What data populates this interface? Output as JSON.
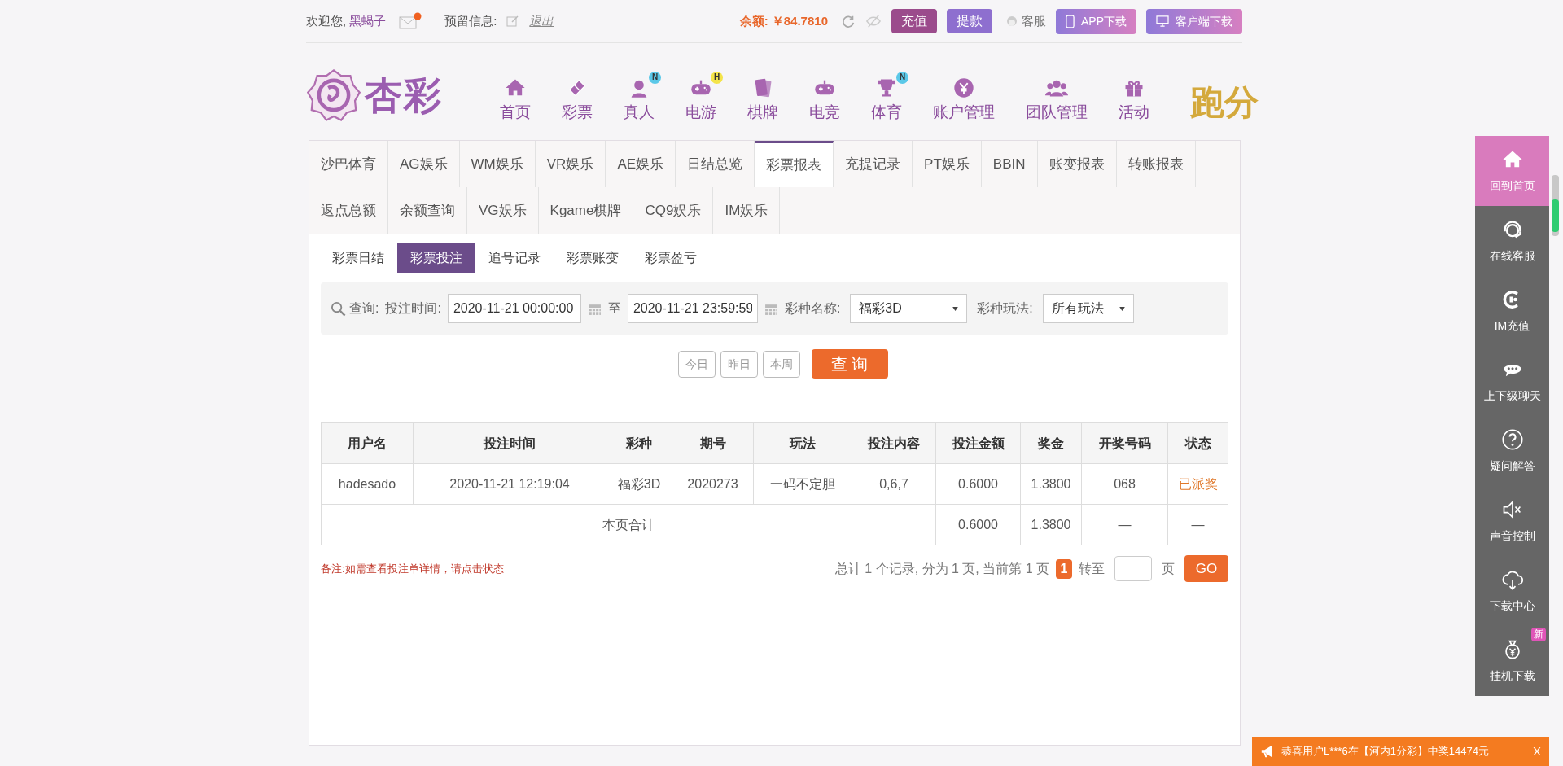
{
  "top_bar": {
    "welcome": "欢迎您,",
    "username": "黑蝎子",
    "reserved_label": "预留信息:",
    "logout": "退出",
    "balance_label": "余额:",
    "balance": "￥84.7810",
    "buttons": [
      {
        "label": "充值",
        "kind": "deposit"
      },
      {
        "label": "提款",
        "kind": "withdraw"
      }
    ],
    "service": "客服",
    "downloads": [
      {
        "label": "APP下载",
        "kind": "phone"
      },
      {
        "label": "客户端下载",
        "kind": "desktop"
      }
    ]
  },
  "logo": {
    "text": "杏彩"
  },
  "nav": [
    {
      "label": "首页"
    },
    {
      "label": "彩票"
    },
    {
      "label": "真人",
      "badge": "N"
    },
    {
      "label": "电游",
      "badge": "H"
    },
    {
      "label": "棋牌"
    },
    {
      "label": "电竞"
    },
    {
      "label": "体育",
      "badge": "N"
    },
    {
      "label": "账户管理"
    },
    {
      "label": "团队管理"
    },
    {
      "label": "活动"
    }
  ],
  "nav_promo": "跑分",
  "report_tabs": [
    {
      "label": "沙巴体育",
      "selected": false
    },
    {
      "label": "AG娱乐",
      "selected": false
    },
    {
      "label": "WM娱乐",
      "selected": false
    },
    {
      "label": "VR娱乐",
      "selected": false
    },
    {
      "label": "AE娱乐",
      "selected": false
    },
    {
      "label": "日结总览",
      "selected": false
    },
    {
      "label": "彩票报表",
      "selected": true
    },
    {
      "label": "充提记录",
      "selected": false
    },
    {
      "label": "PT娱乐",
      "selected": false
    },
    {
      "label": "BBIN",
      "selected": false
    },
    {
      "label": "账变报表",
      "selected": false
    },
    {
      "label": "转账报表",
      "selected": false
    },
    {
      "label": "返点总额",
      "selected": false
    },
    {
      "label": "余额查询",
      "selected": false
    },
    {
      "label": "VG娱乐",
      "selected": false
    },
    {
      "label": "Kgame棋牌",
      "selected": false
    },
    {
      "label": "CQ9娱乐",
      "selected": false
    },
    {
      "label": "IM娱乐",
      "selected": false
    }
  ],
  "sub_tabs": [
    {
      "label": "彩票日结",
      "selected": false
    },
    {
      "label": "彩票投注",
      "selected": true
    },
    {
      "label": "追号记录",
      "selected": false
    },
    {
      "label": "彩票账变",
      "selected": false
    },
    {
      "label": "彩票盈亏",
      "selected": false
    }
  ],
  "search": {
    "label": "查询:",
    "time_label": "投注时间:",
    "start": "2020-11-21 00:00:00",
    "to": "至",
    "end": "2020-11-21 23:59:59",
    "lottery_label": "彩种名称:",
    "lottery": "福彩3D",
    "play_label": "彩种玩法:",
    "play": "所有玩法",
    "quick": [
      "今日",
      "昨日",
      "本周"
    ],
    "submit": "查 询"
  },
  "table": {
    "columns": [
      "用户名",
      "投注时间",
      "彩种",
      "期号",
      "玩法",
      "投注内容",
      "投注金额",
      "奖金",
      "开奖号码",
      "状态"
    ],
    "rows": [
      [
        "hadesado",
        "2020-11-21 12:19:04",
        "福彩3D",
        "2020273",
        "一码不定胆",
        "0,6,7",
        "0.6000",
        "1.3800",
        "068",
        "已派奖"
      ]
    ],
    "total": {
      "label": "本页合计",
      "amount": "0.6000",
      "prize": "1.3800",
      "numbers": "—",
      "status": "—"
    }
  },
  "note": "备注:如需查看投注单详情，请点击状态",
  "pagination": {
    "summary": "总计 1 个记录, 分为 1 页, 当前第 1 页",
    "current": "1",
    "goto": "转至",
    "page": "页",
    "go": "GO"
  },
  "side_menu": [
    {
      "label": "回到首页",
      "selected": true
    },
    {
      "label": "在线客服",
      "selected": false
    },
    {
      "label": "IM充值",
      "selected": false
    },
    {
      "label": "上下级聊天",
      "selected": false
    },
    {
      "label": "疑问解答",
      "selected": false
    },
    {
      "label": "声音控制",
      "selected": false
    },
    {
      "label": "下载中心",
      "selected": false
    },
    {
      "label": "挂机下载",
      "selected": false,
      "badge": "新"
    }
  ],
  "toast": {
    "message": "恭喜用户L***6在【河内1分彩】中奖14474元",
    "close": "X"
  }
}
